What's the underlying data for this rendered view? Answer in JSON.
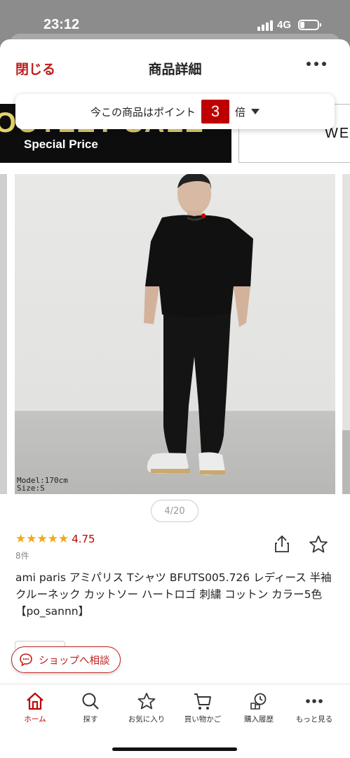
{
  "status": {
    "time": "23:12",
    "network": "4G"
  },
  "header": {
    "close_label": "閉じる",
    "title": "商品詳細"
  },
  "banner": {
    "left_big": "OUTLET SALE",
    "left_sub": "Special Price",
    "right_text": "WE"
  },
  "points": {
    "prefix": "今この商品はポイント",
    "multiplier": "3",
    "suffix": "倍"
  },
  "gallery": {
    "caption_line1": "Model:170cm",
    "caption_line2": "Size:S",
    "pager": "4/20"
  },
  "rating": {
    "stars": "★★★★★",
    "value": "4.75",
    "count": "8件"
  },
  "product": {
    "title": "ami paris アミパリス Tシャツ BFUTS005.726 レディース 半袖 クルーネック カットソー ハートロゴ 刺繍 コットン カラー5色【po_sannn】"
  },
  "consult": {
    "label": "ショップへ相談"
  },
  "nav": {
    "home": "ホーム",
    "search": "探す",
    "favorites": "お気に入り",
    "cart": "買い物かご",
    "history": "購入履歴",
    "more": "もっと見る"
  },
  "colors": {
    "accent": "#bf0000",
    "star": "#f0a81a"
  }
}
